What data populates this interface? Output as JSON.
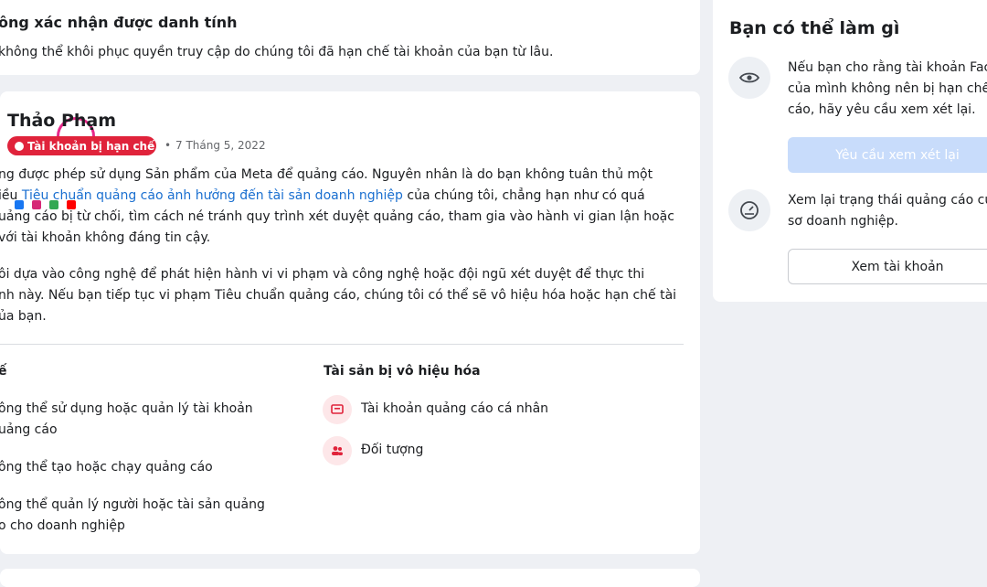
{
  "top_card": {
    "title": "ông xác nhận được danh tính",
    "body": "không thể khôi phục quyền truy cập do chúng tôi đã hạn chế tài khoản của bạn từ lâu."
  },
  "main_card": {
    "name": "Thảo Phạm",
    "badge": "Tài khoản bị hạn chế",
    "date": "7 Tháng 5, 2022",
    "para1": {
      "line1": "ng được phép sử dụng Sản phẩm của Meta để quảng cáo. Nguyên nhân là do bạn không tuân thủ một",
      "line2_pre": "iều ",
      "line2_link": "Tiêu chuẩn quảng cáo ảnh hưởng đến tài sản doanh nghiệp",
      "line2_post": " của chúng tôi, chẳng hạn như có quá",
      "line3": "uảng cáo bị từ chối, tìm cách né tránh quy trình xét duyệt quảng cáo, tham gia vào hành vi gian lận hoặc",
      "line4": "với tài khoản không đáng tin cậy."
    },
    "para2": {
      "line1": "ôi dựa vào công nghệ để phát hiện hành vi vi phạm và công nghệ hoặc đội ngũ xét duyệt để thực thi",
      "line2": "nh này. Nếu bạn tiếp tục vi phạm Tiêu chuẩn quảng cáo, chúng tôi có thể sẽ vô hiệu hóa hoặc hạn chế tài",
      "line3": "ủa bạn."
    },
    "left_col": {
      "heading": "ế",
      "items": [
        {
          "line1": "ông thể sử dụng hoặc quản lý tài khoản",
          "line2": "uảng cáo"
        },
        {
          "line1": "ông thể tạo hoặc chạy quảng cáo",
          "line2": ""
        },
        {
          "line1": "ông thể quản lý người hoặc tài sản quảng",
          "line2": "o cho doanh nghiệp"
        }
      ]
    },
    "right_col": {
      "heading": "Tài sản bị vô hiệu hóa",
      "items": [
        {
          "label": "Tài khoản quảng cáo cá nhân",
          "icon": "ad-account-icon"
        },
        {
          "label": "Đối tượng",
          "icon": "audience-icon"
        }
      ]
    }
  },
  "sidebar": {
    "title": "Bạn có thể làm gì",
    "item1": {
      "line1": "Nếu bạn cho rằng tài khoản Fac",
      "line2": "của mình không nên bị hạn chế",
      "line3": "cáo, hãy yêu cầu xem xét lại.",
      "button": "Yêu cầu xem xét lại"
    },
    "item2": {
      "line1": "Xem lại trạng thái quảng cáo củ",
      "line2": "sơ doanh nghiệp.",
      "button": "Xem tài khoản"
    }
  },
  "colors": {
    "badge": "#e0233b",
    "link": "#1a6fd0",
    "button_disabled": "#c8dcfb"
  }
}
